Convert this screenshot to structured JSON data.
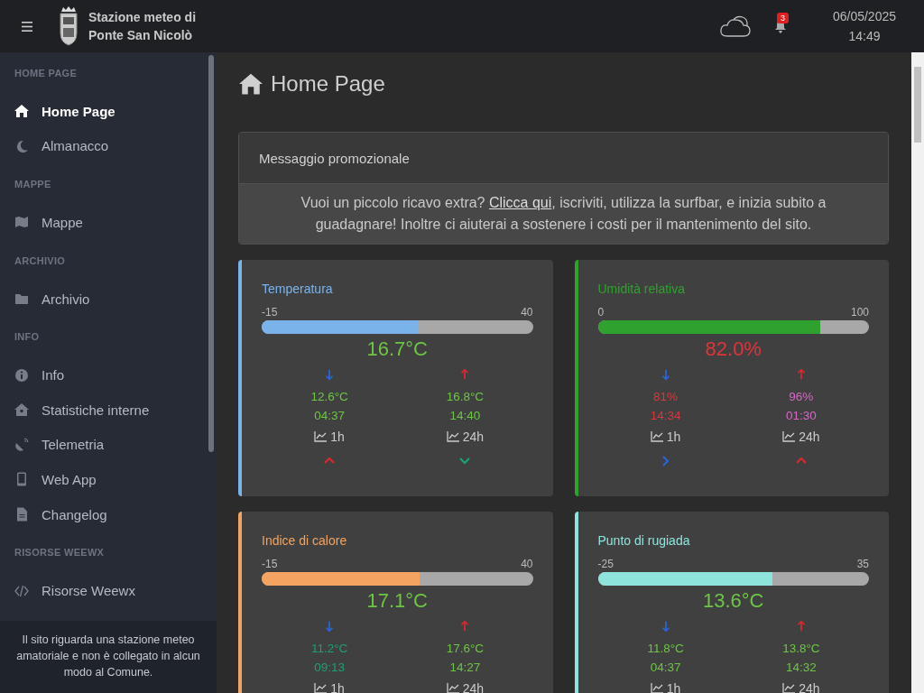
{
  "header": {
    "title_lines": [
      "Stazione meteo di",
      "Ponte San Nicolò"
    ],
    "notifications": "3",
    "date": "06/05/2025",
    "time": "14:49"
  },
  "sidebar": {
    "sections": [
      {
        "heading": "HOME PAGE",
        "items": [
          {
            "label": "Home Page",
            "selected": true
          },
          {
            "label": "Almanacco",
            "selected": false
          }
        ]
      },
      {
        "heading": "MAPPE",
        "items": [
          {
            "label": "Mappe",
            "selected": false
          }
        ]
      },
      {
        "heading": "ARCHIVIO",
        "items": [
          {
            "label": "Archivio",
            "selected": false
          }
        ]
      },
      {
        "heading": "INFO",
        "items": [
          {
            "label": "Info",
            "selected": false
          },
          {
            "label": "Statistiche interne",
            "selected": false
          },
          {
            "label": "Telemetria",
            "selected": false
          },
          {
            "label": "Web App",
            "selected": false
          },
          {
            "label": "Changelog",
            "selected": false
          }
        ]
      },
      {
        "heading": "RISORSE WEEWX",
        "items": [
          {
            "label": "Risorse Weewx",
            "selected": false
          }
        ]
      }
    ],
    "footer": "Il sito riguarda una stazione meteo amatoriale e non è collegato in alcun modo al Comune."
  },
  "page_title": "Home Page",
  "promo": {
    "title": "Messaggio promozionale",
    "text_before": "Vuoi un piccolo ricavo extra?",
    "link": "Clicca qui",
    "text_after": ", iscriviti, utilizza la surfbar, e inizia subito a guadagnare! Inoltre ci aiuterai a sostenere i costi per il mantenimento del sito."
  },
  "cards": [
    {
      "title": "Temperatura",
      "color": "#7ab3ea",
      "min": "-15",
      "max": "40",
      "level": 0.576,
      "current": {
        "value": "16.7°C",
        "color": "#6cc644"
      },
      "low": {
        "value": "12.6°C",
        "time": "04:37",
        "color": "#6cc644"
      },
      "high": {
        "value": "16.8°C",
        "time": "14:40",
        "color": "#6cc644"
      },
      "trends": [
        {
          "label": "1h",
          "kind": "up",
          "color": "#d9282f"
        },
        {
          "label": "24h",
          "kind": "down",
          "color": "#1aa37a"
        }
      ]
    },
    {
      "title": "Umidità relativa",
      "color": "#2ea12e",
      "min": "0",
      "max": "100",
      "level": 0.82,
      "current": {
        "value": "82.0%",
        "color": "#e0343a"
      },
      "low": {
        "value": "81%",
        "time": "14:34",
        "color": "#e0343a"
      },
      "high": {
        "value": "96%",
        "time": "01:30",
        "color": "#d966c8"
      },
      "trends": [
        {
          "label": "1h",
          "kind": "right",
          "color": "#2b63d9"
        },
        {
          "label": "24h",
          "kind": "up",
          "color": "#d9282f"
        }
      ]
    },
    {
      "title": "Indice di calore",
      "color": "#f4a460",
      "min": "-15",
      "max": "40",
      "level": 0.584,
      "current": {
        "value": "17.1°C",
        "color": "#6cc644"
      },
      "low": {
        "value": "11.2°C",
        "time": "09:13",
        "color": "#1f9e74"
      },
      "high": {
        "value": "17.6°C",
        "time": "14:27",
        "color": "#6cc644"
      },
      "trends": [
        {
          "label": "1h"
        },
        {
          "label": "24h"
        }
      ]
    },
    {
      "title": "Punto di rugiada",
      "color": "#8fe3dd",
      "min": "-25",
      "max": "35",
      "level": 0.643,
      "current": {
        "value": "13.6°C",
        "color": "#6cc644"
      },
      "low": {
        "value": "11.8°C",
        "time": "04:37",
        "color": "#6cc644"
      },
      "high": {
        "value": "13.8°C",
        "time": "14:32",
        "color": "#6cc644"
      },
      "trends": [
        {
          "label": "1h"
        },
        {
          "label": "24h"
        }
      ]
    }
  ]
}
